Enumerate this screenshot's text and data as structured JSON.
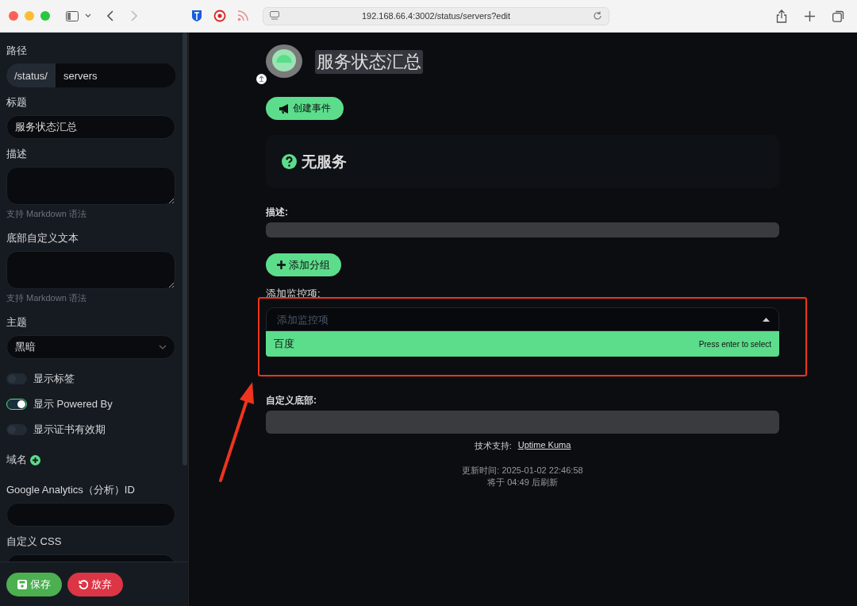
{
  "browser": {
    "url": "192.168.66.4:3002/status/servers?edit"
  },
  "sidebar": {
    "fields": [
      {
        "kind": "prefixed",
        "label": "路径",
        "prefix": "/status/",
        "value": "servers"
      },
      {
        "kind": "text",
        "label": "标题",
        "value": "服务状态汇总"
      },
      {
        "kind": "textarea",
        "label": "描述",
        "hint": "支持 Markdown 语法"
      },
      {
        "kind": "textarea",
        "label": "底部自定义文本",
        "hint": "支持 Markdown 语法"
      },
      {
        "kind": "select",
        "label": "主题",
        "value": "黑暗"
      },
      {
        "kind": "switch",
        "label": "显示标签",
        "on": false
      },
      {
        "kind": "switch",
        "label": "显示 Powered By",
        "on": true
      },
      {
        "kind": "switch",
        "label": "显示证书有效期",
        "on": false
      },
      {
        "kind": "add",
        "label": "域名"
      },
      {
        "kind": "text",
        "label": "Google Analytics（分析）ID"
      },
      {
        "kind": "cut",
        "label": "自定义 CSS"
      }
    ],
    "buttons": [
      {
        "kind": "save",
        "label": "保存"
      },
      {
        "kind": "discard",
        "label": "放弃"
      }
    ]
  },
  "main": {
    "title": "服务状态汇总",
    "create_incident": "创建事件",
    "overall_status": "无服务",
    "description_label": "描述:",
    "add_group": "添加分组",
    "add_monitor_label": "添加监控项:",
    "monitor_select": {
      "placeholder": "添加监控项",
      "expanded": true,
      "options": [
        {
          "label": "百度",
          "hint": "Press enter to select",
          "selected": true
        }
      ]
    },
    "footer_label": "自定义底部:",
    "powered_by_label": "技术支持:",
    "powered_by_link": "Uptime Kuma",
    "updated": "更新时间: 2025-01-02 22:46:58",
    "refresh": "将于 04:49 后刷新"
  },
  "annotations": {
    "highlight_box": true,
    "arrow": true
  }
}
